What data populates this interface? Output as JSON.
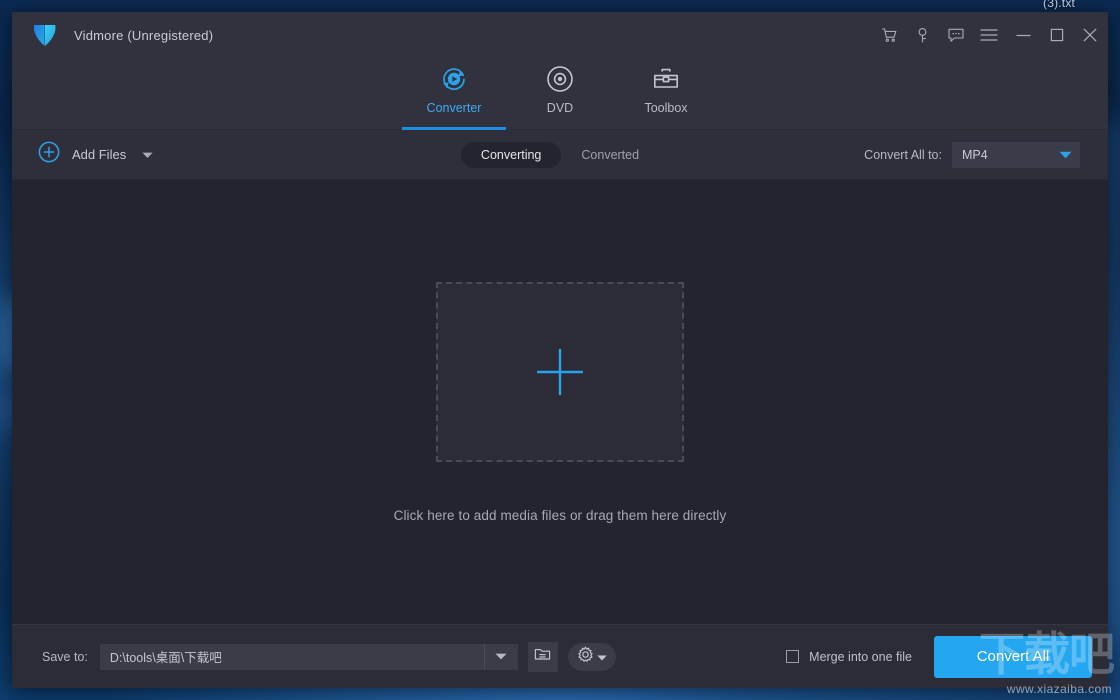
{
  "desktop": {
    "partial_file_label": "(3).txt"
  },
  "window": {
    "title": "Vidmore (Unregistered)",
    "logo_icon": "vidmore-shield-logo"
  },
  "titlebar_buttons": [
    {
      "name": "cart-icon",
      "label": "Buy"
    },
    {
      "name": "key-icon",
      "label": "Register"
    },
    {
      "name": "feedback-icon",
      "label": "Feedback"
    },
    {
      "name": "menu-icon",
      "label": "Menu"
    },
    {
      "name": "minimize-icon",
      "label": "Minimize"
    },
    {
      "name": "maximize-icon",
      "label": "Maximize"
    },
    {
      "name": "close-icon",
      "label": "Close"
    }
  ],
  "nav": {
    "tabs": [
      {
        "label": "Converter",
        "icon": "converter-icon",
        "active": true
      },
      {
        "label": "DVD",
        "icon": "dvd-disc-icon",
        "active": false
      },
      {
        "label": "Toolbox",
        "icon": "toolbox-icon",
        "active": false
      }
    ]
  },
  "toolbar": {
    "add_files_label": "Add Files",
    "add_files_icon": "plus-circle-icon",
    "add_files_caret_icon": "chevron-down-icon",
    "segments": [
      {
        "label": "Converting",
        "active": true
      },
      {
        "label": "Converted",
        "active": false
      }
    ],
    "convert_all_to_label": "Convert All to:",
    "format_value": "MP4",
    "format_caret_icon": "chevron-down-icon"
  },
  "main": {
    "plus_icon": "plus-icon",
    "hint": "Click here to add media files or drag them here directly"
  },
  "bottom": {
    "save_to_label": "Save to:",
    "path_value": "D:\\tools\\桌面\\下载吧",
    "path_caret_icon": "chevron-down-icon",
    "folder_icon": "folder-open-icon",
    "gear_icon": "gear-icon",
    "gear_caret_icon": "chevron-down-icon",
    "merge_label": "Merge into one file",
    "merge_checked": false,
    "convert_all_button": "Convert All"
  },
  "watermark": {
    "chinese": "下载吧",
    "url": "www.xiazaiba.com"
  },
  "colors": {
    "accent_blue": "#25a6f0",
    "tab_active_blue": "#3fa9f5",
    "titlebar_bg": "#32323f",
    "content_bg": "#23242e",
    "toolbar_bg": "#2e2f3a",
    "bottombar_bg": "#2b2c36"
  }
}
